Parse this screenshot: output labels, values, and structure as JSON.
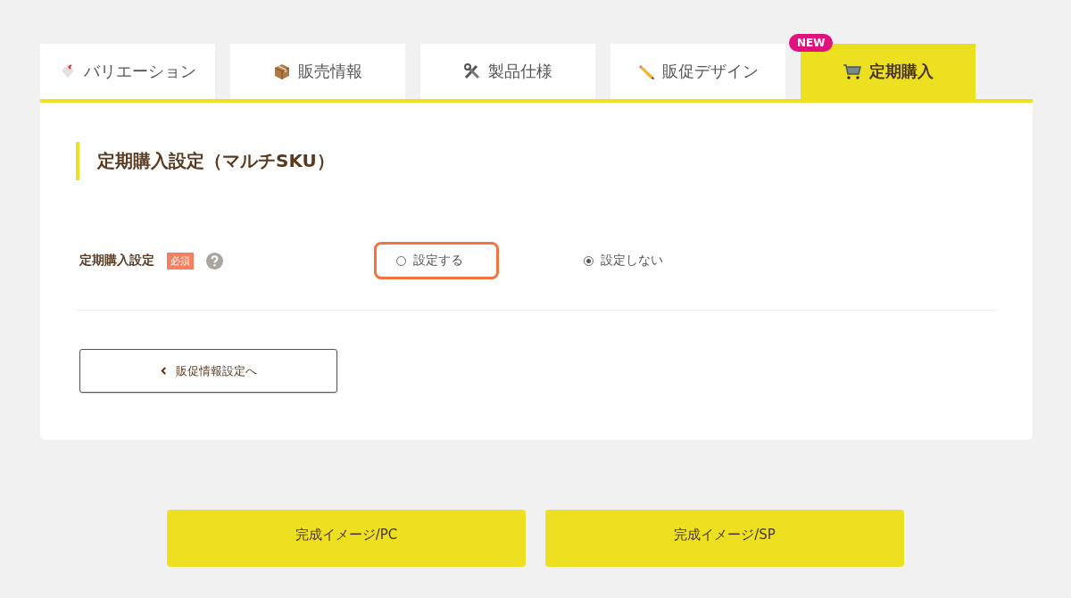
{
  "tabs": [
    {
      "label": "バリエーション",
      "selected": false
    },
    {
      "label": "販売情報",
      "selected": false
    },
    {
      "label": "製品仕様",
      "selected": false
    },
    {
      "label": "販促デザイン",
      "selected": false
    },
    {
      "label": "定期購入",
      "selected": true,
      "badge": "NEW"
    }
  ],
  "section": {
    "title": "定期購入設定（マルチSKU）"
  },
  "field": {
    "label": "定期購入設定",
    "required_badge": "必須",
    "options": [
      {
        "label": "設定する",
        "selected": false,
        "highlighted": true
      },
      {
        "label": "設定しない",
        "selected": true,
        "highlighted": false
      }
    ]
  },
  "back_button": {
    "label": "販促情報設定へ"
  },
  "preview_buttons": [
    "完成イメージ/PC",
    "完成イメージ/SP"
  ]
}
